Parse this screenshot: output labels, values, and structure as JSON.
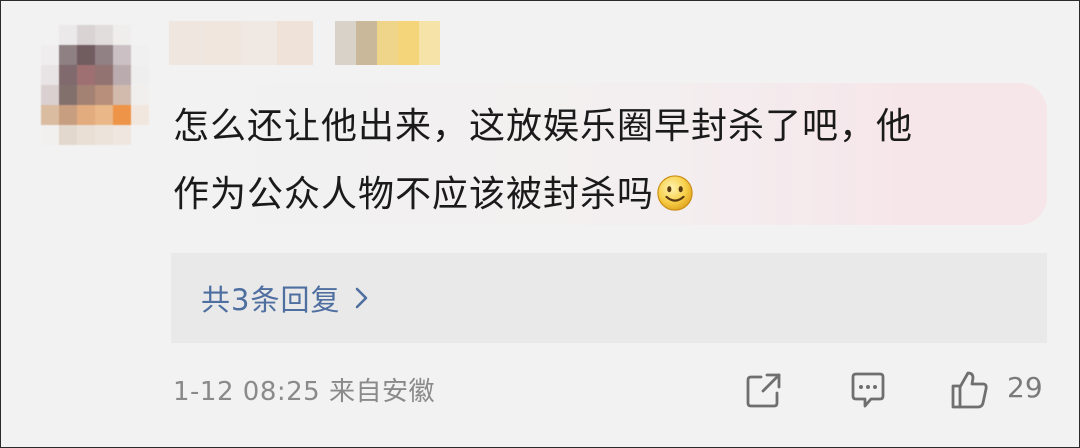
{
  "comment": {
    "line1": "怎么还让他出来，这放娱乐圈早封杀了吧，他",
    "line2": "作为公众人物不应该被封杀吗",
    "emoji": "smile-icon"
  },
  "replies": {
    "label": "共3条回复"
  },
  "footer": {
    "timestamp": "1-12 08:25",
    "location": "来自安徽",
    "like_count": "29"
  },
  "icons": {
    "share": "share-icon",
    "reply": "comment-icon",
    "like": "thumbs-up-icon",
    "chevron": "chevron-right-icon"
  },
  "colors": {
    "background": "#f2f2f2",
    "link": "#4e6fa0",
    "meta_text": "#8a8a8a",
    "bubble_tint": "#f6e5e9",
    "replies_bg": "#e9e9e9"
  }
}
